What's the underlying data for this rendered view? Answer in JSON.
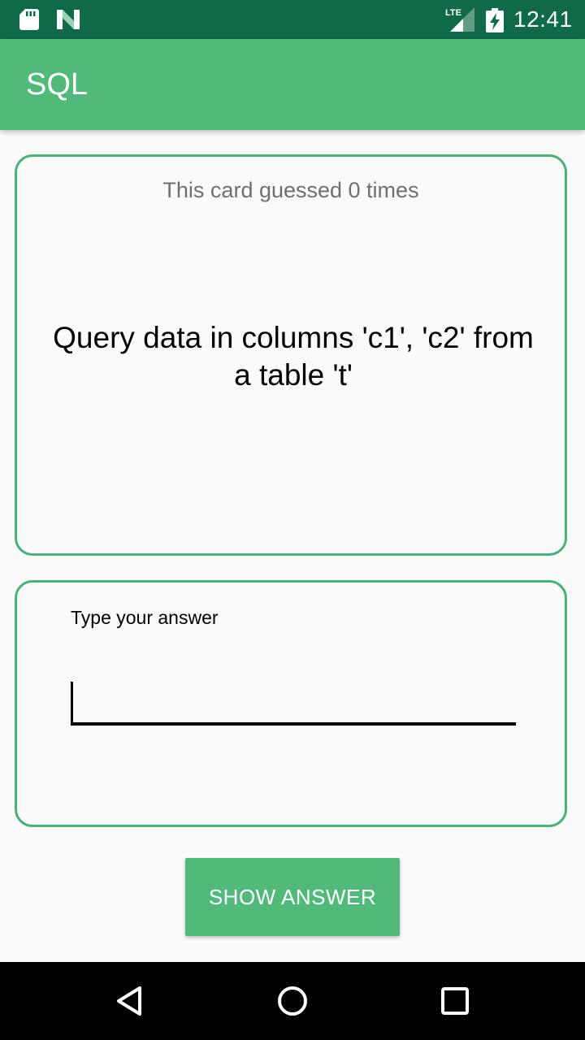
{
  "status_bar": {
    "time": "12:41",
    "icons": [
      "sd-card-icon",
      "n-notification-icon",
      "lte-signal-icon",
      "battery-charging-icon"
    ],
    "background_color": "#0f6a48"
  },
  "app_bar": {
    "title": "SQL",
    "background_color": "#51ba7b"
  },
  "question_card": {
    "guess_count_text": "This card guessed 0 times",
    "question_text": "Query data in columns 'c1', 'c2' from a table 't'",
    "border_color": "#4caf7a"
  },
  "answer_card": {
    "label": "Type your answer",
    "input_value": "",
    "border_color": "#4caf7a"
  },
  "actions": {
    "show_answer_label": "SHOW ANSWER",
    "button_color": "#51ba7b"
  },
  "nav_bar": {
    "icons": [
      "back-icon",
      "home-icon",
      "recents-icon"
    ]
  }
}
